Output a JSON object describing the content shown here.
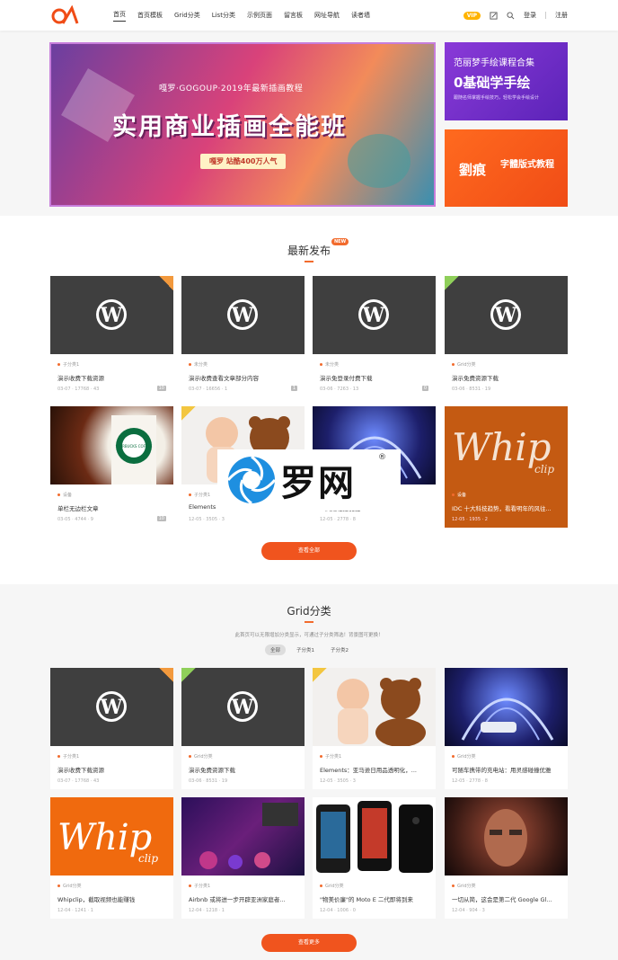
{
  "header": {
    "nav": [
      "首页",
      "首页模板",
      "Grid分类",
      "List分类",
      "示例页面",
      "留言板",
      "网址导航",
      "读者墙"
    ],
    "vip": "VIP",
    "login": "登录",
    "register": "注册"
  },
  "banner": {
    "main_line1": "嘎罗·GOGOUP·2019年最新插画教程",
    "main_title": "实用商业插画全能班",
    "main_badge": "嘎罗 站酷400万人气",
    "side1_line1": "范丽梦手绘课程合集",
    "side1_line2": "0基础学手绘",
    "side1_line3": "跟随名师掌握手绘技巧，轻松学会手绘设计",
    "side2_name": "劉痕",
    "side2_line": "字體版式教程"
  },
  "latest": {
    "title": "最新发布",
    "badge": "NEW",
    "more": "查看全部",
    "cards": [
      {
        "cat": "子分类1",
        "title": "演示收费下载资源",
        "meta": "03-07 · 17768 · 43",
        "count": "10"
      },
      {
        "cat": "未分类",
        "title": "演示收费查看文章部分内容",
        "meta": "03-07 · 16656 · 1",
        "count": "1"
      },
      {
        "cat": "未分类",
        "title": "演示免登录付费下载",
        "meta": "03-06 · 7263 · 13",
        "count": "0"
      },
      {
        "cat": "Grid分类",
        "title": "演示免费资源下载",
        "meta": "03-06 · 8531 · 19",
        "count": ""
      },
      {
        "cat": "设备",
        "title": "单栏无边栏文章",
        "meta": "03-05 · 4744 · 9",
        "count": "10"
      },
      {
        "cat": "子分类1",
        "title": "Elements",
        "meta": "12-05 · 3505 · 3",
        "count": ""
      },
      {
        "cat": "",
        "title": "...风险碰撞优雅",
        "meta": "12-05 · 2778 · 8",
        "count": ""
      },
      {
        "cat": "设备",
        "title": "IDC 十大科技趋势，看看明年的风往...",
        "meta": "12-05 · 1935 · 2",
        "count": ""
      }
    ]
  },
  "grid": {
    "title": "Grid分类",
    "desc": "此首页可以无限增加分类显示，可通过子分类筛选！背景图可更换！",
    "tabs": [
      "全部",
      "子分类1",
      "子分类2"
    ],
    "more": "查看更多",
    "cards": [
      {
        "cat": "子分类1",
        "title": "演示收费下载资源",
        "meta": "03-07 · 17768 · 43"
      },
      {
        "cat": "Grid分类",
        "title": "演示免费资源下载",
        "meta": "03-06 · 8531 · 19"
      },
      {
        "cat": "子分类1",
        "title": "Elements：亚马逊日用品透明化，...",
        "meta": "12-05 · 3505 · 3"
      },
      {
        "cat": "Grid分类",
        "title": "可随车携带的充电站：用灵感碰撞优雅",
        "meta": "12-05 · 2778 · 8"
      },
      {
        "cat": "Grid分类",
        "title": "Whipclip，截取视频也能赚钱",
        "meta": "12-04 · 1241 · 1"
      },
      {
        "cat": "子分类1",
        "title": "Airbnb 或将进一步开辟亚洲家庭者...",
        "meta": "12-04 · 1218 · 1"
      },
      {
        "cat": "Grid分类",
        "title": "\"物美价廉\"的 Moto E 二代即将到来",
        "meta": "12-04 · 1006 · 0"
      },
      {
        "cat": "Grid分类",
        "title": "一切从简，这会是第二代 Google Gl...",
        "meta": "12-04 · 904 · 3"
      }
    ]
  },
  "watermark": {
    "text": "罗网",
    "mark": "®"
  },
  "thumb_text": {
    "starbucks": "STARBUCKS COFFEE",
    "whip": "Whip",
    "clip": "clip"
  },
  "colors": {
    "accent": "#f26b2d",
    "button": "#f0541e"
  }
}
